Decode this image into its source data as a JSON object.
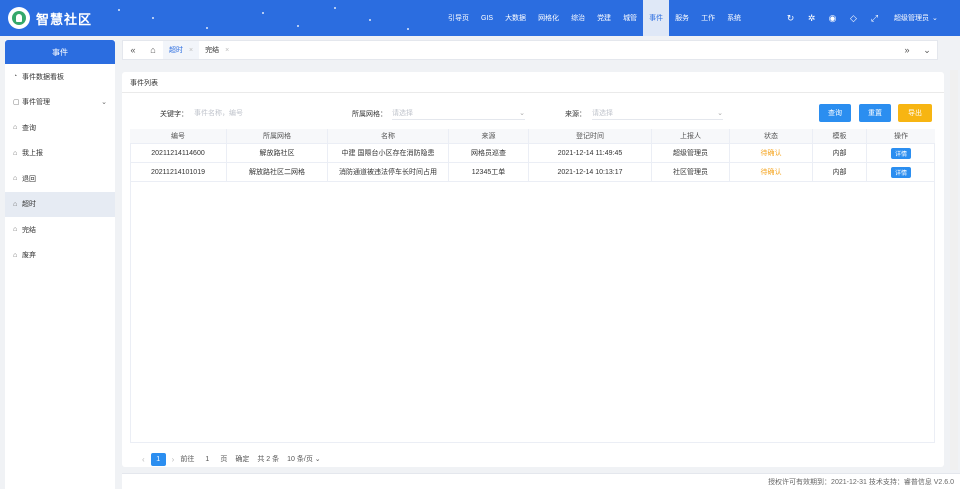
{
  "app": {
    "title": "智慧社区"
  },
  "topnav": [
    {
      "label": "引导页",
      "active": false
    },
    {
      "label": "GIS",
      "active": false
    },
    {
      "label": "大数据",
      "active": false
    },
    {
      "label": "网格化",
      "active": false
    },
    {
      "label": "综治",
      "active": false
    },
    {
      "label": "党建",
      "active": false
    },
    {
      "label": "城管",
      "active": false
    },
    {
      "label": "事件",
      "active": true
    },
    {
      "label": "服务",
      "active": false
    },
    {
      "label": "工作",
      "active": false
    },
    {
      "label": "系统",
      "active": false
    }
  ],
  "top_icons": [
    "refresh-icon",
    "settings-icon",
    "eye-icon",
    "tag-icon",
    "fullscreen-icon"
  ],
  "user": {
    "name": "超级管理员"
  },
  "sidebar": {
    "title": "事件",
    "items": [
      {
        "label": "事件数据看板",
        "icon": "dashboard-icon",
        "active": false,
        "has_arrow": false
      },
      {
        "label": "事件管理",
        "icon": "folder-icon",
        "active": false,
        "has_arrow": true
      },
      {
        "label": "查询",
        "icon": "page-icon",
        "active": false,
        "has_arrow": false
      },
      {
        "label": "我上报",
        "icon": "page-icon",
        "active": false,
        "has_arrow": false
      },
      {
        "label": "退回",
        "icon": "page-icon",
        "active": false,
        "has_arrow": false
      },
      {
        "label": "超时",
        "icon": "page-icon",
        "active": true,
        "has_arrow": false
      },
      {
        "label": "完结",
        "icon": "page-icon",
        "active": false,
        "has_arrow": false
      },
      {
        "label": "废弃",
        "icon": "page-icon",
        "active": false,
        "has_arrow": false
      }
    ]
  },
  "tabs": [
    {
      "label": "超时",
      "active": true
    },
    {
      "label": "完结",
      "active": false
    }
  ],
  "card": {
    "title": "事件列表"
  },
  "filters": {
    "keyword_label": "关键字：",
    "keyword_placeholder": "事件名称，编号",
    "grid_label": "所属网格：",
    "grid_placeholder": "请选择",
    "source_label": "来源：",
    "source_placeholder": "请选择"
  },
  "buttons": {
    "query": "查询",
    "reset": "重置",
    "export": "导出"
  },
  "colors": {
    "primary": "#2b6de0",
    "button_blue": "#2b8ef0",
    "export_yellow": "#f7b512",
    "status_orange": "#f5a623"
  },
  "table": {
    "headers": [
      "编号",
      "所属网格",
      "名称",
      "来源",
      "登记时间",
      "上报人",
      "状态",
      "模板",
      "操作"
    ],
    "rows": [
      [
        "20211214114600",
        "解放路社区",
        "中建 国際台小区存在消防隐患",
        "网格员巡查",
        "2021-12-14 11:49:45",
        "超级管理员",
        "待确认",
        "内部",
        "详情"
      ],
      [
        "20211214101019",
        "解放路社区二网格",
        "消防通道被违法停车长时间占用",
        "12345工单",
        "2021-12-14 10:13:17",
        "社区管理员",
        "待确认",
        "内部",
        "详情"
      ]
    ]
  },
  "pager": {
    "current": "1",
    "goto_label": "前往",
    "goto_value": "1",
    "page_unit": "页",
    "confirm": "确定",
    "total": "共 2 条",
    "page_size": "10 条/页"
  },
  "footer": {
    "text": "授权许可有效期到：2021-12-31  技术支持：睿普信息  V2.6.0"
  }
}
